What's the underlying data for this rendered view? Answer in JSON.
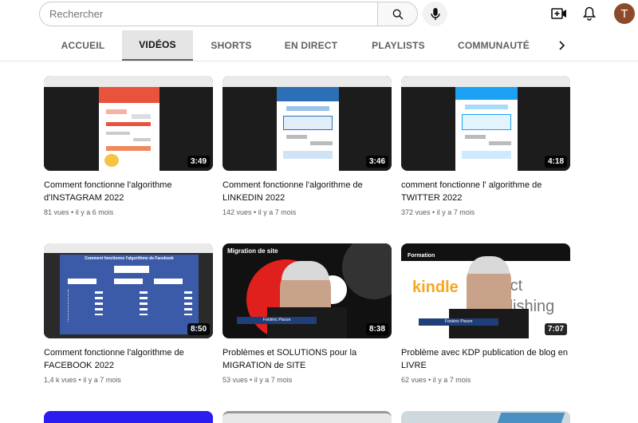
{
  "search": {
    "placeholder": "Rechercher"
  },
  "user": {
    "initial": "T"
  },
  "tabs": [
    "ACCUEIL",
    "VIDÉOS",
    "SHORTS",
    "EN DIRECT",
    "PLAYLISTS",
    "COMMUNAUTÉ"
  ],
  "active_tab": "VIDÉOS",
  "videos": [
    {
      "title": "Comment fonctionne l'algorithme d'INSTAGRAM 2022",
      "duration": "3:49",
      "views": "81 vues",
      "age": "il y a 6 mois"
    },
    {
      "title": "Comment fonctionne l'algorithme de LINKEDIN 2022",
      "duration": "3:46",
      "views": "142 vues",
      "age": "il y a 7 mois"
    },
    {
      "title": "comment fonctionne l' algorithme de TWITTER 2022",
      "duration": "4:18",
      "views": "372 vues",
      "age": "il y a 7 mois"
    },
    {
      "title": "Comment fonctionne l'algorithme de FACEBOOK 2022",
      "duration": "8:50",
      "views": "1,4 k vues",
      "age": "il y a 7 mois"
    },
    {
      "title": "Problèmes et SOLUTIONS pour la MIGRATION de SITE",
      "duration": "8:38",
      "views": "53 vues",
      "age": "il y a 7 mois"
    },
    {
      "title": "Problème avec KDP publication de blog en LIVRE",
      "duration": "7:07",
      "views": "62 vues",
      "age": "il y a 7 mois"
    }
  ],
  "thumb_text": {
    "facebook": "Comment fonctionne l'algorithme de Facebook",
    "migration": "Migration de site",
    "formation": "Formation",
    "kindle": "kindle",
    "publishing": "Direct Publishing",
    "presenter": "Frédéric Pisson"
  },
  "meta_separator": "•",
  "colors": {
    "accent": "#0f0f0f",
    "instagram": "#e8543b",
    "linkedin": "#2d6fb5",
    "twitter": "#1da1f2",
    "facebook": "#3b5ba9",
    "migration": "#e0201c",
    "kindle": "#f6a623"
  }
}
